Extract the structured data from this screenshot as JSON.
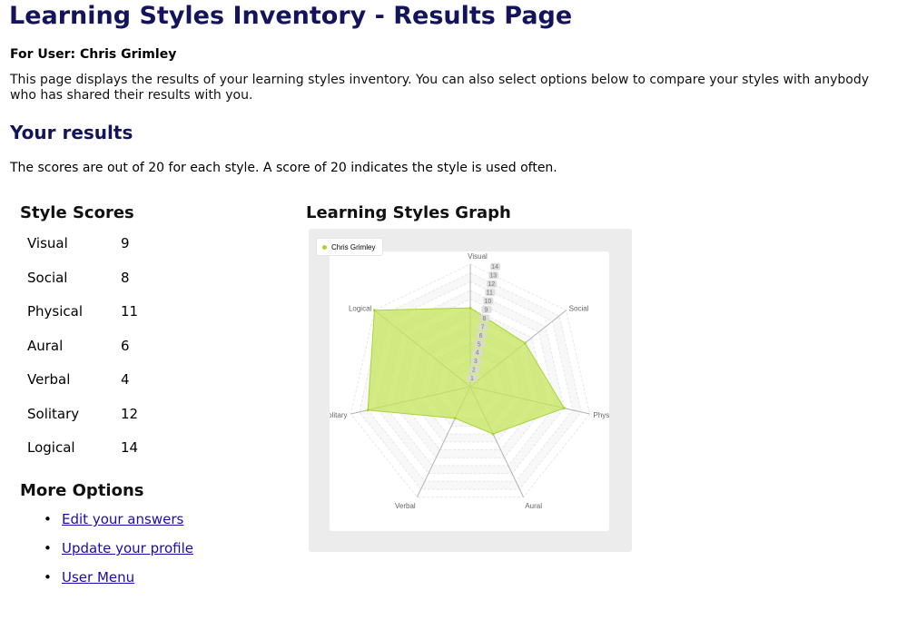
{
  "page": {
    "title": "Learning Styles Inventory - Results Page",
    "user_line": "For User: Chris Grimley",
    "intro": "This page displays the results of your learning styles inventory. You can also select options below to compare your styles with anybody who has shared their results with you.",
    "results_heading": "Your results",
    "scores_note": "The scores are out of 20 for each style. A score of 20 indicates the style is used often."
  },
  "scores": {
    "heading": "Style Scores",
    "rows": [
      {
        "style": "Visual",
        "score": "9"
      },
      {
        "style": "Social",
        "score": "8"
      },
      {
        "style": "Physical",
        "score": "11"
      },
      {
        "style": "Aural",
        "score": "6"
      },
      {
        "style": "Verbal",
        "score": "4"
      },
      {
        "style": "Solitary",
        "score": "12"
      },
      {
        "style": "Logical",
        "score": "14"
      }
    ]
  },
  "options": {
    "heading": "More Options",
    "links": [
      "Edit your answers",
      "Update your profile",
      "User Menu"
    ]
  },
  "graph": {
    "heading": "Learning Styles Graph",
    "legend_label": "Chris Grimley",
    "fill_color": "#c5e45a",
    "dot_color": "#a8d43a"
  },
  "chart_data": {
    "type": "radar",
    "categories": [
      "Visual",
      "Social",
      "Physical",
      "Aural",
      "Verbal",
      "Solitary",
      "Logical"
    ],
    "series": [
      {
        "name": "Chris Grimley",
        "values": [
          9,
          8,
          11,
          6,
          4,
          12,
          14
        ]
      }
    ],
    "tick_labels": [
      "1",
      "2",
      "3",
      "4",
      "5",
      "6",
      "7",
      "8",
      "9",
      "10",
      "11",
      "12",
      "13",
      "14"
    ],
    "rlim": [
      0,
      14
    ],
    "grid": true,
    "legend_position": "top-left"
  }
}
